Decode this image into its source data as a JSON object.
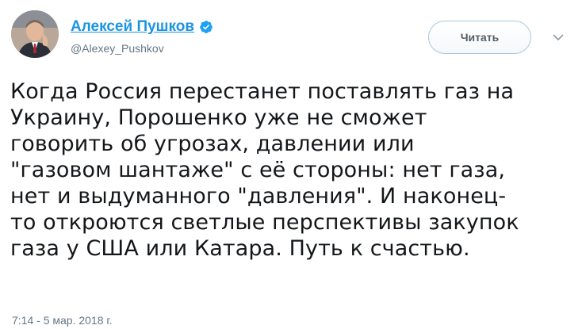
{
  "author": {
    "display_name": "Алексей Пушков",
    "handle": "@Alexey_Pushkov",
    "verified": true,
    "avatar_icon": "person-avatar-icon"
  },
  "actions": {
    "follow_label": "Читать",
    "menu_icon": "chevron-down-icon"
  },
  "tweet": {
    "lines": [
      "Когда Россия перестанет поставлять газ на",
      "Украину, Порошенко уже не сможет",
      "говорить об угрозах, давлении или",
      "\"газовом шантаже\" с её стороны: нет газа,",
      "нет и выдуманного \"давления\". И наконец-",
      "то откроются светлые перспективы закупок",
      "газа у США или Катара. Путь к счастью."
    ],
    "timestamp": "7:14 - 5 мар. 2018 г."
  },
  "colors": {
    "name_link": "#1c94e0",
    "secondary_text": "#657786",
    "verified_badge": "#1da1f2",
    "body_text": "#14171a"
  }
}
